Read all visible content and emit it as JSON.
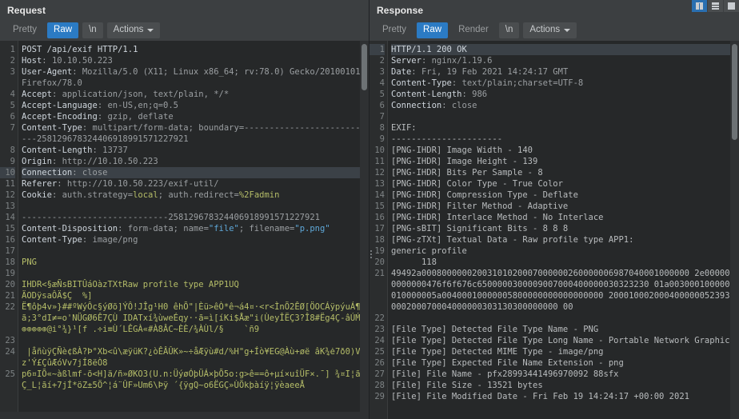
{
  "layout_toggles": [
    {
      "name": "split-vertical",
      "icon": "columns-icon",
      "active": true
    },
    {
      "name": "split-horizontal",
      "icon": "rows-icon",
      "active": false
    },
    {
      "name": "single-pane",
      "icon": "single-pane-icon",
      "active": false
    }
  ],
  "request": {
    "title": "Request",
    "toolbar": {
      "pretty": "Pretty",
      "raw": "Raw",
      "newline": "\\n",
      "actions": "Actions",
      "caret_icon": "chevron-down-icon",
      "active": "Raw"
    },
    "highlight_line": 10,
    "lines": [
      {
        "n": 1,
        "segs": [
          {
            "t": "POST /api/exif HTTP/1.1",
            "c": "hname"
          }
        ]
      },
      {
        "n": 2,
        "segs": [
          {
            "t": "Host",
            "c": "hname"
          },
          {
            "t": ": 10.10.50.223",
            "c": "hval"
          }
        ]
      },
      {
        "n": 3,
        "segs": [
          {
            "t": "User-Agent",
            "c": "hname"
          },
          {
            "t": ": Mozilla/5.0 (X11; Linux x86_64; rv:78.0) Gecko/20100101 Firefox/78.0",
            "c": "hval"
          }
        ]
      },
      {
        "n": 4,
        "segs": [
          {
            "t": "Accept",
            "c": "hname"
          },
          {
            "t": ": application/json, text/plain, */*",
            "c": "hval"
          }
        ]
      },
      {
        "n": 5,
        "segs": [
          {
            "t": "Accept-Language",
            "c": "hname"
          },
          {
            "t": ": en-US,en;q=0.5",
            "c": "hval"
          }
        ]
      },
      {
        "n": 6,
        "segs": [
          {
            "t": "Accept-Encoding",
            "c": "hname"
          },
          {
            "t": ": gzip, deflate",
            "c": "hval"
          }
        ]
      },
      {
        "n": 7,
        "segs": [
          {
            "t": "Content-Type",
            "c": "hname"
          },
          {
            "t": ": multipart/form-data; boundary=---------------------------258129678324406918991571227921",
            "c": "hval"
          }
        ]
      },
      {
        "n": 8,
        "segs": [
          {
            "t": "Content-Length",
            "c": "hname"
          },
          {
            "t": ": 13737",
            "c": "hval"
          }
        ]
      },
      {
        "n": 9,
        "segs": [
          {
            "t": "Origin",
            "c": "hname"
          },
          {
            "t": ": http://10.10.50.223",
            "c": "hval"
          }
        ]
      },
      {
        "n": 10,
        "segs": [
          {
            "t": "Connection",
            "c": "hname"
          },
          {
            "t": ": close",
            "c": "hval"
          }
        ]
      },
      {
        "n": 11,
        "segs": [
          {
            "t": "Referer",
            "c": "hname"
          },
          {
            "t": ": http://10.10.50.223/exif-util/",
            "c": "hval"
          }
        ]
      },
      {
        "n": 12,
        "segs": [
          {
            "t": "Cookie",
            "c": "hname"
          },
          {
            "t": ": auth.strategy=",
            "c": "hval"
          },
          {
            "t": "local",
            "c": "ck"
          },
          {
            "t": "; auth.redirect=",
            "c": "hval"
          },
          {
            "t": "%2Fadmin",
            "c": "ck"
          }
        ]
      },
      {
        "n": 13,
        "segs": []
      },
      {
        "n": 14,
        "segs": [
          {
            "t": "-----------------------------258129678324406918991571227921",
            "c": "hval"
          }
        ]
      },
      {
        "n": 15,
        "segs": [
          {
            "t": "Content-Disposition",
            "c": "hname"
          },
          {
            "t": ": form-data; name=",
            "c": "hval"
          },
          {
            "t": "\"file\"",
            "c": "str"
          },
          {
            "t": "; filename=",
            "c": "hval"
          },
          {
            "t": "\"p.png\"",
            "c": "str"
          }
        ]
      },
      {
        "n": 16,
        "segs": [
          {
            "t": "Content-Type",
            "c": "hname"
          },
          {
            "t": ": image/png",
            "c": "hval"
          }
        ]
      },
      {
        "n": 17,
        "segs": []
      },
      {
        "n": 18,
        "segs": [
          {
            "t": "PNG",
            "c": "bin"
          }
        ]
      },
      {
        "n": 19,
        "segs": []
      },
      {
        "n": 20,
        "segs": [
          {
            "t": "IHDR<§æÑsBITÛáOàzTXtRaw profile type APP1UQ",
            "c": "bin"
          }
        ]
      },
      {
        "n": 21,
        "segs": [
          {
            "t": "ÄODÿsaÔÄ$Ç  %]",
            "c": "bin"
          }
        ]
      },
      {
        "n": 22,
        "segs": [
          {
            "t": "Ë¶ôþ4v»}##ºWýÔc§ýØõ]ÝÔ!JÎg¹H0 êhÕ\"|Èü>êÒ*ê¬á4¤·<r<ÌnÕ2ÊØ[ÖOCÁÿpýuÁ¶ã;3°dI≠=o'NÜGØ6Ê7ÇÙ IDATxí¾ùweÉqy··ã=ì[íKi$Åæ\"i(ÙeyÎËÇ3?Î8#Ëg4Ç-âÚḾ÷⊕⊕⊕⊕⊕@i°¾}¹[f .÷i≡Ù´LÊGÀ«#À8ÂC~ÈÈ/¾ÀÙl/§    `ñ9",
            "c": "bin"
          }
        ]
      },
      {
        "n": 23,
        "segs": []
      },
      {
        "n": 24,
        "segs": [
          {
            "t": " |åñùÿÇÑè¢ßÀ?Þ°Xb<û\\æÿüK?¿òÊÂÛK»~÷åÆÿù#d/%H\"g+Íò¥EG@Àù+øë âK¾ė7ð0)Vz'Ý£ÇûÆóVv7jÍ8ëÒ8",
            "c": "bin"
          }
        ]
      },
      {
        "n": 25,
        "segs": [
          {
            "t": "p6¤IÕ«~àßlmf-õ<H]ä/ñ»ØKO3(U.n:ÜýøÓþÜÁ×þÕ5o:g>ê==ô+µí×uîÜF×.¯] ¾¤I¦ãÃÇ_L¦ãí+7jÍ*öZ±5Ö^¦á¨ÛF»Um6\\Þÿ ´{ÿgQ~o6ËGÇ»ÙÕkþàíÿ¦ÿèaeeÅ",
            "c": "bin"
          }
        ]
      }
    ]
  },
  "response": {
    "title": "Response",
    "toolbar": {
      "pretty": "Pretty",
      "raw": "Raw",
      "render": "Render",
      "newline": "\\n",
      "actions": "Actions",
      "caret_icon": "chevron-down-icon",
      "active": "Raw"
    },
    "highlight_line": 1,
    "lines": [
      {
        "n": 1,
        "segs": [
          {
            "t": "HTTP/1.1 200 OK",
            "c": "hname"
          }
        ]
      },
      {
        "n": 2,
        "segs": [
          {
            "t": "Server",
            "c": "hname"
          },
          {
            "t": ": nginx/1.19.6",
            "c": "hval"
          }
        ]
      },
      {
        "n": 3,
        "segs": [
          {
            "t": "Date",
            "c": "hname"
          },
          {
            "t": ": Fri, 19 Feb 2021 14:24:17 GMT",
            "c": "hval"
          }
        ]
      },
      {
        "n": 4,
        "segs": [
          {
            "t": "Content-Type",
            "c": "hname"
          },
          {
            "t": ": text/plain;charset=UTF-8",
            "c": "hval"
          }
        ]
      },
      {
        "n": 5,
        "segs": [
          {
            "t": "Content-Length",
            "c": "hname"
          },
          {
            "t": ": 986",
            "c": "hval"
          }
        ]
      },
      {
        "n": 6,
        "segs": [
          {
            "t": "Connection",
            "c": "hname"
          },
          {
            "t": ": close",
            "c": "hval"
          }
        ]
      },
      {
        "n": 7,
        "segs": []
      },
      {
        "n": 8,
        "segs": [
          {
            "t": "EXIF:",
            "c": "plain"
          }
        ]
      },
      {
        "n": 9,
        "segs": [
          {
            "t": "----------------------",
            "c": "plain"
          }
        ]
      },
      {
        "n": 10,
        "segs": [
          {
            "t": "[PNG-IHDR] Image Width - 140",
            "c": "plain"
          }
        ]
      },
      {
        "n": 11,
        "segs": [
          {
            "t": "[PNG-IHDR] Image Height - 139",
            "c": "plain"
          }
        ]
      },
      {
        "n": 12,
        "segs": [
          {
            "t": "[PNG-IHDR] Bits Per Sample - 8",
            "c": "plain"
          }
        ]
      },
      {
        "n": 13,
        "segs": [
          {
            "t": "[PNG-IHDR] Color Type - True Color",
            "c": "plain"
          }
        ]
      },
      {
        "n": 14,
        "segs": [
          {
            "t": "[PNG-IHDR] Compression Type - Deflate",
            "c": "plain"
          }
        ]
      },
      {
        "n": 15,
        "segs": [
          {
            "t": "[PNG-IHDR] Filter Method - Adaptive",
            "c": "plain"
          }
        ]
      },
      {
        "n": 16,
        "segs": [
          {
            "t": "[PNG-IHDR] Interlace Method - No Interlace",
            "c": "plain"
          }
        ]
      },
      {
        "n": 17,
        "segs": [
          {
            "t": "[PNG-sBIT] Significant Bits - 8 8 8",
            "c": "plain"
          }
        ]
      },
      {
        "n": 18,
        "segs": [
          {
            "t": "[PNG-zTXt] Textual Data - Raw profile type APP1:",
            "c": "plain"
          }
        ]
      },
      {
        "n": 19,
        "segs": [
          {
            "t": "generic profile",
            "c": "plain"
          }
        ]
      },
      {
        "n": 20,
        "segs": [
          {
            "t": "      118",
            "c": "plain"
          }
        ]
      },
      {
        "n": 21,
        "segs": [
          {
            "t": "49492a00080000002003101020007000000260000006987040001000000 2e0000000000000476f6f676c6500000300009007000400000030323230 01a0030001000000010000005a00400010000005800000000000000000 2000100020004000000523938000200070004000000303130300000000 00",
            "c": "plain"
          }
        ]
      },
      {
        "n": 22,
        "segs": []
      },
      {
        "n": 23,
        "segs": [
          {
            "t": "[File Type] Detected File Type Name - PNG",
            "c": "plain"
          }
        ]
      },
      {
        "n": 24,
        "segs": [
          {
            "t": "[File Type] Detected File Type Long Name - Portable Network Graphics",
            "c": "plain"
          }
        ]
      },
      {
        "n": 25,
        "segs": [
          {
            "t": "[File Type] Detected MIME Type - image/png",
            "c": "plain"
          }
        ]
      },
      {
        "n": 26,
        "segs": [
          {
            "t": "[File Type] Expected File Name Extension - png",
            "c": "plain"
          }
        ]
      },
      {
        "n": 27,
        "segs": [
          {
            "t": "[File] File Name - pfx28993441496970092 88sfx",
            "c": "plain"
          }
        ]
      },
      {
        "n": 28,
        "segs": [
          {
            "t": "[File] File Size - 13521 bytes",
            "c": "plain"
          }
        ]
      },
      {
        "n": 29,
        "segs": [
          {
            "t": "[File] File Modified Date - Fri Feb 19 14:24:17 +00:00 2021",
            "c": "plain"
          }
        ]
      }
    ]
  }
}
